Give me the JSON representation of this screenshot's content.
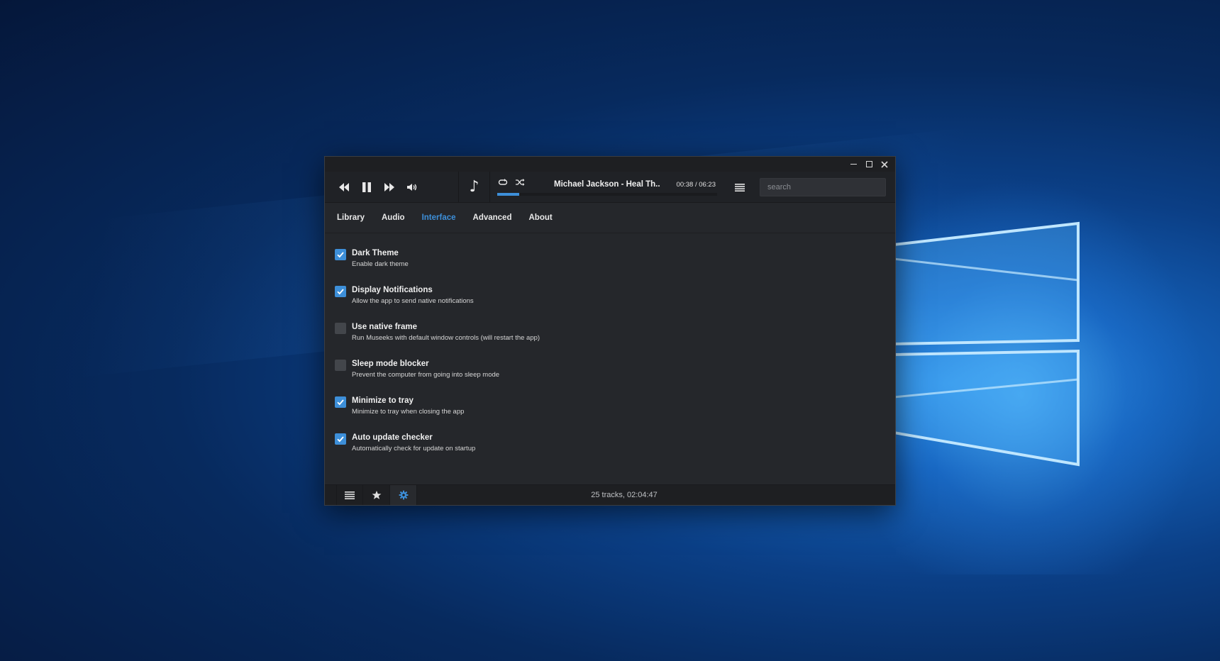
{
  "window_controls": {
    "minimize": "minimize-icon",
    "maximize": "maximize-icon",
    "close": "close-icon"
  },
  "player": {
    "controls": [
      "previous-icon",
      "pause-icon",
      "next-icon",
      "volume-icon"
    ],
    "now_playing_title": "Michael Jackson - Heal Th...",
    "time": "00:38 / 06:23",
    "progress": 0.1,
    "repeat_icon": "repeat-icon",
    "shuffle_icon": "shuffle-icon"
  },
  "search": {
    "placeholder": "search",
    "value": ""
  },
  "tabs": [
    {
      "label": "Library",
      "active": false
    },
    {
      "label": "Audio",
      "active": false
    },
    {
      "label": "Interface",
      "active": true
    },
    {
      "label": "Advanced",
      "active": false
    },
    {
      "label": "About",
      "active": false
    }
  ],
  "settings": [
    {
      "title": "Dark Theme",
      "description": "Enable dark theme",
      "checked": true
    },
    {
      "title": "Display Notifications",
      "description": "Allow the app to send native notifications",
      "checked": true
    },
    {
      "title": "Use native frame",
      "description": "Run Museeks with default window controls (will restart the app)",
      "checked": false
    },
    {
      "title": "Sleep mode blocker",
      "description": "Prevent the computer from going into sleep mode",
      "checked": false
    },
    {
      "title": "Minimize to tray",
      "description": "Minimize to tray when closing the app",
      "checked": true
    },
    {
      "title": "Auto update checker",
      "description": "Automatically check for update on startup",
      "checked": true
    }
  ],
  "footer": {
    "status": "25 tracks, 02:04:47",
    "buttons": [
      "list-icon",
      "star-icon",
      "gear-icon"
    ],
    "active_button": "gear-icon"
  },
  "colors": {
    "accent": "#3d8fd9",
    "window_bg": "#25272b",
    "header_bg": "#202226"
  }
}
